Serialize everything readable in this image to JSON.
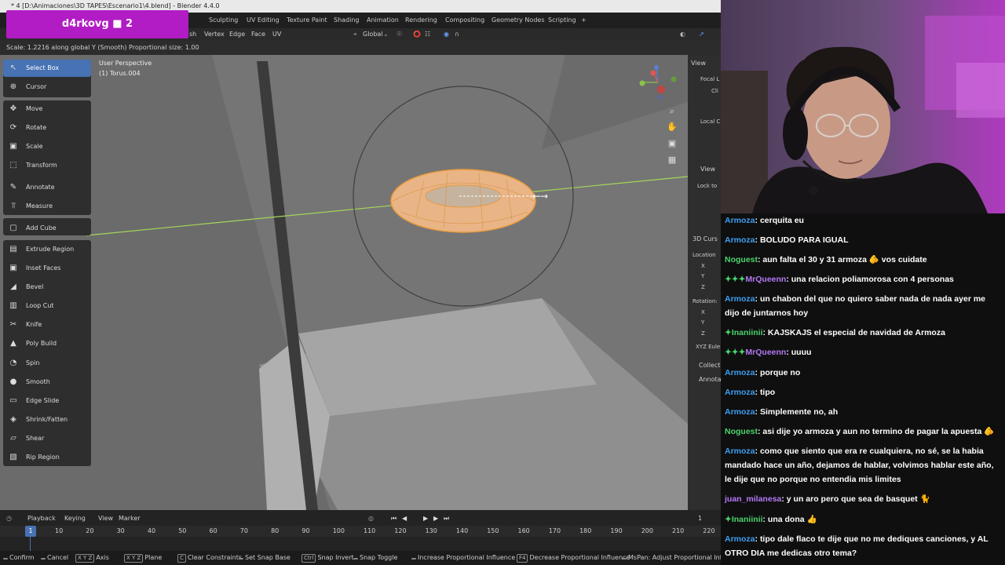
{
  "blender": {
    "title": "* 4 [D:\\Animaciones\\3D TAPES\\Escenario1\\4.blend] - Blender 4.4.0",
    "workspace_tabs": [
      "Sculpting",
      "UV Editing",
      "Texture Paint",
      "Shading",
      "Animation",
      "Rendering",
      "Compositing",
      "Geometry Nodes",
      "Scripting",
      "+"
    ],
    "header_menu": [
      "sh",
      "Vertex",
      "Edge",
      "Face",
      "UV"
    ],
    "transform_orientation": "Global",
    "operator_status": "Scale: 1.2216 along global Y (Smooth) Proportional size: 1.00",
    "overlay_name": "d4rkovg ■ 2",
    "viewport": {
      "perspective": "User Perspective",
      "object": "(1) Torus.004"
    },
    "tools": [
      {
        "label": "Select Box",
        "icon": "select-box-icon",
        "glyph": "↖",
        "active": true
      },
      {
        "label": "Cursor",
        "icon": "cursor-icon",
        "glyph": "⊕"
      },
      {
        "label": "Move",
        "icon": "move-icon",
        "glyph": "✥"
      },
      {
        "label": "Rotate",
        "icon": "rotate-icon",
        "glyph": "⟳"
      },
      {
        "label": "Scale",
        "icon": "scale-icon",
        "glyph": "▣"
      },
      {
        "label": "Transform",
        "icon": "transform-icon",
        "glyph": "⬚"
      },
      {
        "label": "Annotate",
        "icon": "annotate-icon",
        "glyph": "✎"
      },
      {
        "label": "Measure",
        "icon": "measure-icon",
        "glyph": "⫪"
      },
      {
        "label": "Add Cube",
        "icon": "add-cube-icon",
        "glyph": "▢"
      },
      {
        "label": "Extrude Region",
        "icon": "extrude-icon",
        "glyph": "▤"
      },
      {
        "label": "Inset Faces",
        "icon": "inset-icon",
        "glyph": "▣"
      },
      {
        "label": "Bevel",
        "icon": "bevel-icon",
        "glyph": "◢"
      },
      {
        "label": "Loop Cut",
        "icon": "loop-cut-icon",
        "glyph": "▥"
      },
      {
        "label": "Knife",
        "icon": "knife-icon",
        "glyph": "✂"
      },
      {
        "label": "Poly Build",
        "icon": "poly-build-icon",
        "glyph": "▲"
      },
      {
        "label": "Spin",
        "icon": "spin-icon",
        "glyph": "◔"
      },
      {
        "label": "Smooth",
        "icon": "smooth-icon",
        "glyph": "●"
      },
      {
        "label": "Edge Slide",
        "icon": "edge-slide-icon",
        "glyph": "▭"
      },
      {
        "label": "Shrink/Fatten",
        "icon": "shrink-fatten-icon",
        "glyph": "◈"
      },
      {
        "label": "Shear",
        "icon": "shear-icon",
        "glyph": "▱"
      },
      {
        "label": "Rip Region",
        "icon": "rip-region-icon",
        "glyph": "▧"
      }
    ],
    "npanel": {
      "view": "View",
      "focal": "Focal L",
      "clip": "Cli",
      "local": "Local C",
      "view2": "View",
      "lock": "Lock to",
      "cursor": "3D Curs",
      "location": "Location",
      "rotation": "Rotation:",
      "x": "X",
      "y": "Y",
      "z": "Z",
      "euler": "XYZ Eule",
      "collection": "Collecti",
      "annotations": "Annotat"
    },
    "timeline": {
      "menus": [
        "Playback",
        "Keying",
        "View",
        "Marker"
      ],
      "current_frame": "1",
      "frame_label": "1",
      "ticks": [
        "10",
        "20",
        "30",
        "40",
        "50",
        "60",
        "70",
        "80",
        "90",
        "100",
        "110",
        "120",
        "130",
        "140",
        "150",
        "160",
        "170",
        "180",
        "190",
        "200",
        "210",
        "220"
      ]
    },
    "hints": [
      {
        "key": "",
        "text": "Confirm"
      },
      {
        "key": "",
        "text": "Cancel"
      },
      {
        "key": "X Y Z",
        "text": "Axis"
      },
      {
        "key": "X Y Z",
        "text": "Plane"
      },
      {
        "key": "C",
        "text": "Clear Constraints"
      },
      {
        "key": "",
        "text": "Set Snap Base"
      },
      {
        "key": "Ctrl",
        "text": "Snap Invert"
      },
      {
        "key": "",
        "text": "Snap Toggle"
      },
      {
        "key": "",
        "text": "Increase Proportional Influence"
      },
      {
        "key": "F4",
        "text": "Decrease Proportional Influence"
      },
      {
        "key": "",
        "text": "MsPan: Adjust Proportional Influence"
      }
    ]
  },
  "chat": {
    "messages": [
      {
        "user": "Armoza",
        "color": "#3c9ff0",
        "badges": "",
        "text": "cerquita eu"
      },
      {
        "user": "Armoza",
        "color": "#3c9ff0",
        "badges": "",
        "text": "BOLUDO PARA IGUAL"
      },
      {
        "user": "Noguest",
        "color": "#4bd46b",
        "badges": "",
        "text": "aun falta el 30 y 31 armoza 🫵 vos cuidate"
      },
      {
        "user": "MrQueenn",
        "color": "#b678f5",
        "badges": "✦✦✦",
        "text": "una relacion poliamorosa con 4 personas"
      },
      {
        "user": "Armoza",
        "color": "#3c9ff0",
        "badges": "",
        "text": "un chabon del que no quiero saber nada de nada ayer me dijo de juntarnos hoy"
      },
      {
        "user": "Inaniinii",
        "color": "#4bd46b",
        "badges": "✦",
        "text": "KAJSKAJS el especial de navidad de Armoza"
      },
      {
        "user": "MrQueenn",
        "color": "#b678f5",
        "badges": "✦✦✦",
        "text": "uuuu"
      },
      {
        "user": "Armoza",
        "color": "#3c9ff0",
        "badges": "",
        "text": "porque no"
      },
      {
        "user": "Armoza",
        "color": "#3c9ff0",
        "badges": "",
        "text": "tipo"
      },
      {
        "user": "Armoza",
        "color": "#3c9ff0",
        "badges": "",
        "text": "Simplemente no, ah"
      },
      {
        "user": "Noguest",
        "color": "#4bd46b",
        "badges": "",
        "text": "asi dije yo armoza y aun no termino de pagar la apuesta 🫵"
      },
      {
        "user": "Armoza",
        "color": "#3c9ff0",
        "badges": "",
        "text": "como que siento que era re cualquiera, no sé, se la habia mandado hace un año, dejamos de hablar, volvimos hablar este año, le dije que no porque no entendia mis limites"
      },
      {
        "user": "juan_milanesa",
        "color": "#b678f5",
        "badges": "",
        "text": "y un aro pero que sea de basquet 🐈"
      },
      {
        "user": "Inaniinii",
        "color": "#4bd46b",
        "badges": "✦",
        "text": "una dona 👍"
      },
      {
        "user": "Armoza",
        "color": "#3c9ff0",
        "badges": "",
        "text": "tipo dale flaco te dije que no me dediques canciones, y AL OTRO DIA me dedicas otro tema?"
      }
    ]
  },
  "colors": {
    "accent": "#4772b3",
    "selection": "#f0a050",
    "overlay": "#b21cc4"
  }
}
